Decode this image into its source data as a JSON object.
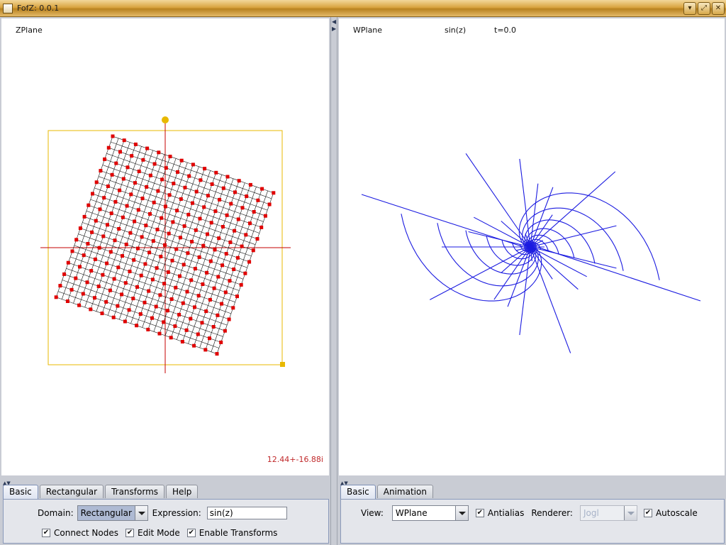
{
  "window": {
    "title": "FofZ: 0.0.1"
  },
  "zplane": {
    "label": "ZPlane",
    "coord_readout": "12.44+-16.88i",
    "colors": {
      "grid_nodes": "#e00000",
      "axes": "#c40000",
      "bounding_box": "#e8b800"
    }
  },
  "wplane": {
    "label": "WPlane",
    "expression": "sin(z)",
    "time": "t=0.0",
    "colors": {
      "curves": "#1a1ae0"
    }
  },
  "left_controls": {
    "tabs": [
      {
        "label": "Basic",
        "active": true
      },
      {
        "label": "Rectangular",
        "active": false
      },
      {
        "label": "Transforms",
        "active": false
      },
      {
        "label": "Help",
        "active": false
      }
    ],
    "domain_label": "Domain:",
    "domain_value": "Rectangular",
    "expression_label": "Expression:",
    "expression_value": "sin(z)",
    "checkboxes": [
      {
        "label": "Connect Nodes",
        "checked": true
      },
      {
        "label": "Edit Mode",
        "checked": true
      },
      {
        "label": "Enable Transforms",
        "checked": true
      }
    ]
  },
  "right_controls": {
    "tabs": [
      {
        "label": "Basic",
        "active": true
      },
      {
        "label": "Animation",
        "active": false
      }
    ],
    "view_label": "View:",
    "view_value": "WPlane",
    "antialias_label": "Antialias",
    "antialias_checked": true,
    "renderer_label": "Renderer:",
    "renderer_value": "Jogl",
    "autoscale_label": "Autoscale",
    "autoscale_checked": true
  }
}
